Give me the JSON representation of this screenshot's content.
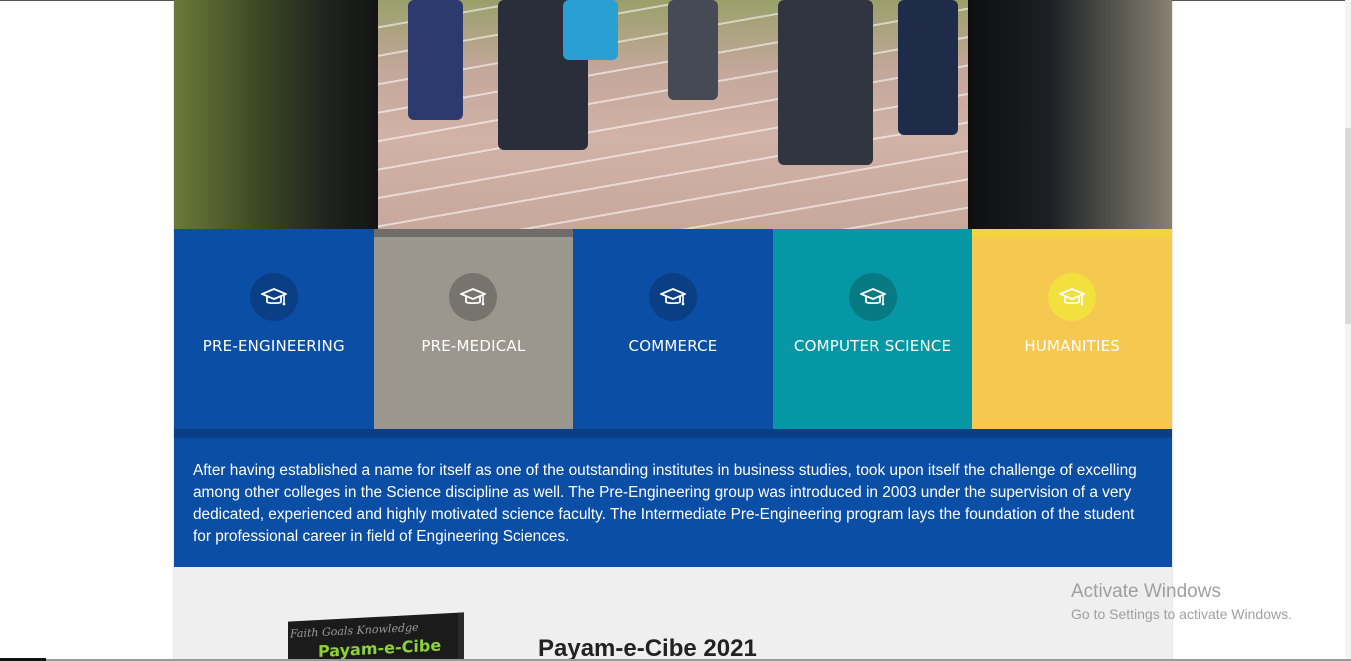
{
  "hero": {
    "image_alt": "students-at-start-line"
  },
  "programs": [
    {
      "label": "PRE-ENGINEERING",
      "icon": "graduation-cap-icon",
      "color": "#0b4ea5"
    },
    {
      "label": "PRE-MEDICAL",
      "icon": "graduation-cap-icon",
      "color": "#9b978e"
    },
    {
      "label": "COMMERCE",
      "icon": "graduation-cap-icon",
      "color": "#0b4ea5"
    },
    {
      "label": "COMPUTER SCIENCE",
      "icon": "graduation-cap-icon",
      "color": "#0597a3"
    },
    {
      "label": "HUMANITIES",
      "icon": "graduation-cap-icon",
      "color": "#f5c950"
    }
  ],
  "description": {
    "text": "After having established a name for itself as one of the outstanding institutes in business studies, took upon itself the challenge of excelling among other colleges in the Science discipline as well. The Pre-Engineering group was introduced in 2003 under the supervision of a very dedicated, experienced and highly motivated science faculty. The Intermediate Pre-Engineering program lays the foundation of the student for professional career in field of Engineering Sciences."
  },
  "publication": {
    "cover_words": "Faith   Goals   Knowledge",
    "cover_title": "Payam-e-Cibe",
    "title": "Payam-e-Cibe 2021"
  },
  "watermark": {
    "line1": "Activate Windows",
    "line2": "Go to Settings to activate Windows."
  }
}
